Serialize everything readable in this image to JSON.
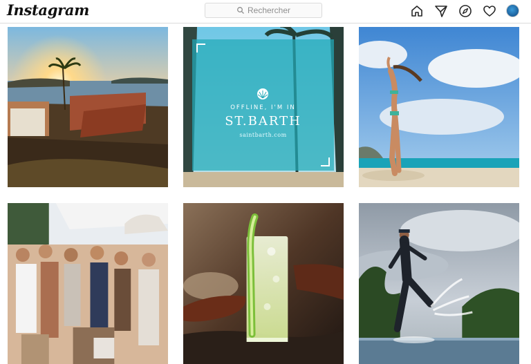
{
  "app": {
    "logo_text": "Instagram"
  },
  "search": {
    "placeholder": "Rechercher",
    "icon": "search-icon"
  },
  "nav": {
    "icons": [
      "home-icon",
      "direct-message-icon",
      "explore-compass-icon",
      "activity-heart-icon",
      "profile-avatar"
    ]
  },
  "colors": {
    "border": "#dbdbdb",
    "search_bg": "#fafafa",
    "placeholder_text": "#8e8e8e",
    "overlay_teal": "#23aab9"
  },
  "posts": [
    {
      "id": 1,
      "subject": "sunset over coastal villa"
    },
    {
      "id": 2,
      "subject": "St Barth promo overlay",
      "overlay": {
        "line1": "OFFLINE, I'M IN",
        "title": "ST.BARTH",
        "url": "saintbarth.com"
      }
    },
    {
      "id": 3,
      "subject": "woman on beach with blue sky"
    },
    {
      "id": 4,
      "subject": "group party by the pool"
    },
    {
      "id": 5,
      "subject": "cocktail glass with cucumber"
    },
    {
      "id": 6,
      "subject": "man kicking water at pool edge"
    }
  ]
}
